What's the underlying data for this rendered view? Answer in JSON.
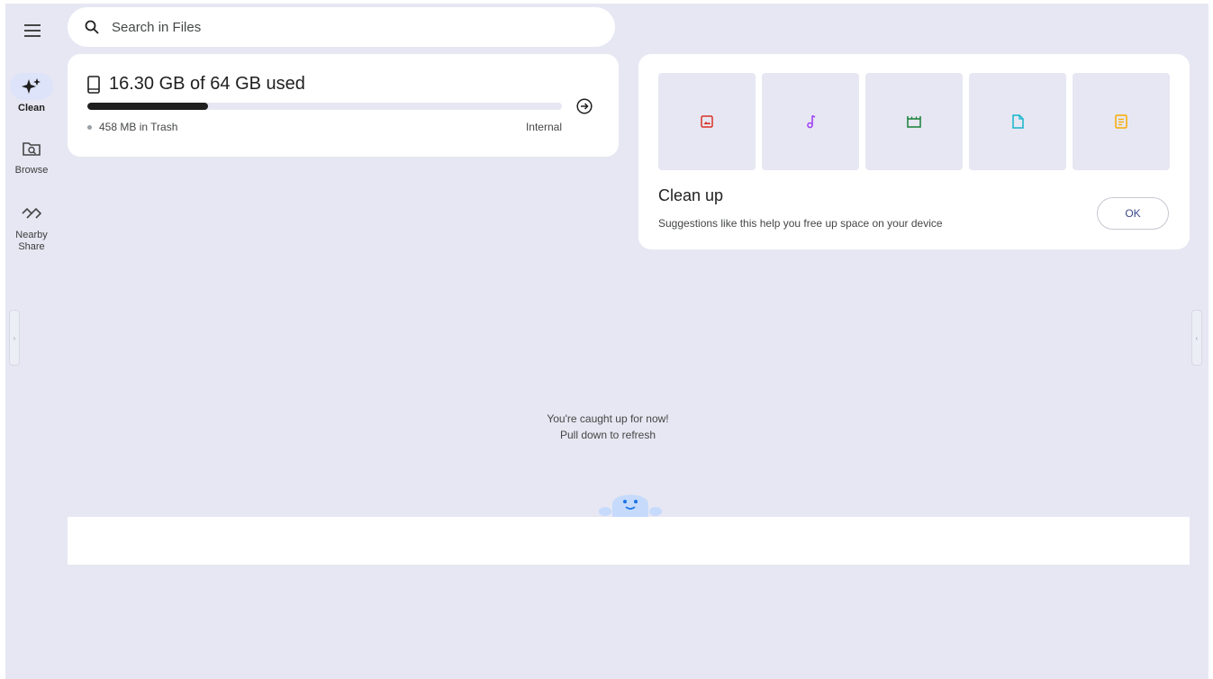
{
  "search": {
    "placeholder": "Search in Files"
  },
  "nav": {
    "items": [
      {
        "label": "Clean",
        "icon": "sparkle-icon",
        "active": true
      },
      {
        "label": "Browse",
        "icon": "folder-search-icon",
        "active": false
      },
      {
        "label": "Nearby Share",
        "icon": "nearby-share-icon",
        "active": false
      }
    ]
  },
  "storage": {
    "title": "16.30 GB of 64 GB used",
    "used_fraction": 0.2547,
    "trash": "458 MB in Trash",
    "location": "Internal"
  },
  "cleanup": {
    "title": "Clean up",
    "subtitle": "Suggestions like this help you free up space on your device",
    "ok_label": "OK",
    "tiles": [
      {
        "icon": "image-icon",
        "color": "#d93025"
      },
      {
        "icon": "music-note-icon",
        "color": "#a142f4"
      },
      {
        "icon": "video-clapper-icon",
        "color": "#188038"
      },
      {
        "icon": "document-icon",
        "color": "#12b5cb"
      },
      {
        "icon": "notes-icon",
        "color": "#f9ab00"
      }
    ]
  },
  "empty_state": {
    "line1": "You're caught up for now!",
    "line2": "Pull down to refresh"
  },
  "colors": {
    "background": "#e6e7f2",
    "card": "#ffffff",
    "active_nav": "#dde3f9",
    "progress": "#1f1f1f",
    "mascot": "#c6dafc"
  }
}
